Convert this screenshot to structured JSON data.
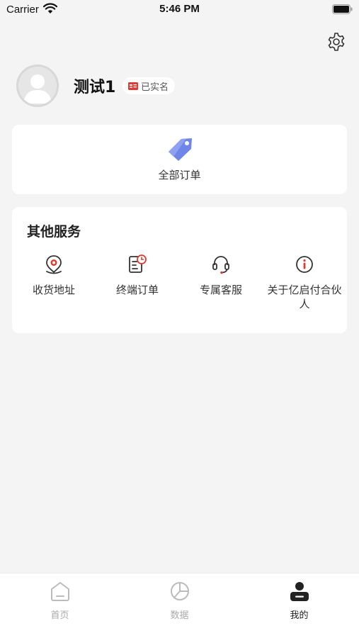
{
  "status_bar": {
    "carrier": "Carrier",
    "time": "5:46 PM"
  },
  "profile": {
    "username": "测试1",
    "verified_label": "已实名"
  },
  "orders": {
    "all_orders_label": "全部订单"
  },
  "services": {
    "title": "其他服务",
    "items": [
      {
        "label": "收货地址",
        "icon": "location-pin-icon"
      },
      {
        "label": "终端订单",
        "icon": "order-clock-icon"
      },
      {
        "label": "专属客服",
        "icon": "headset-icon"
      },
      {
        "label": "关于亿启付合伙人",
        "icon": "info-icon"
      }
    ]
  },
  "tabs": [
    {
      "label": "首页",
      "icon": "home-icon",
      "active": false
    },
    {
      "label": "数据",
      "icon": "pie-chart-icon",
      "active": false
    },
    {
      "label": "我的",
      "icon": "user-icon",
      "active": true
    }
  ],
  "colors": {
    "accent_red": "#e03a32",
    "tag_blue": "#6f86e8",
    "active_tab": "#222222"
  }
}
